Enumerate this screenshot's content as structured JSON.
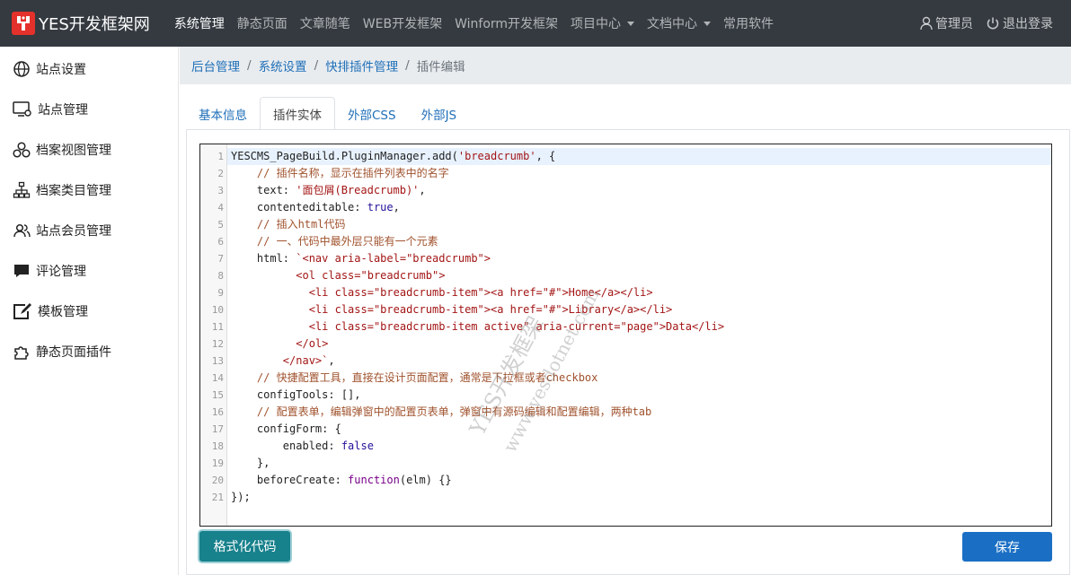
{
  "app": {
    "brand": "YES开发框架网",
    "brand_color": "#e4312b"
  },
  "topnav": {
    "items": [
      {
        "label": "系统管理",
        "active": true,
        "dropdown": false
      },
      {
        "label": "静态页面",
        "active": false,
        "dropdown": false
      },
      {
        "label": "文章随笔",
        "active": false,
        "dropdown": false
      },
      {
        "label": "WEB开发框架",
        "active": false,
        "dropdown": false
      },
      {
        "label": "Winform开发框架",
        "active": false,
        "dropdown": false
      },
      {
        "label": "项目中心",
        "active": false,
        "dropdown": true
      },
      {
        "label": "文档中心",
        "active": false,
        "dropdown": true
      },
      {
        "label": "常用软件",
        "active": false,
        "dropdown": false
      }
    ],
    "user_label": "管理员",
    "user_icon": "user-icon",
    "logout_label": "退出登录",
    "logout_icon": "power-icon"
  },
  "sidebar": {
    "items": [
      {
        "label": "站点设置",
        "icon": "globe-icon"
      },
      {
        "label": "站点管理",
        "icon": "monitor-gear-icon"
      },
      {
        "label": "档案视图管理",
        "icon": "circles-icon"
      },
      {
        "label": "档案类目管理",
        "icon": "sitemap-icon"
      },
      {
        "label": "站点会员管理",
        "icon": "users-icon"
      },
      {
        "label": "评论管理",
        "icon": "comment-icon"
      },
      {
        "label": "模板管理",
        "icon": "edit-box-icon"
      },
      {
        "label": "静态页面插件",
        "icon": "puzzle-icon"
      }
    ]
  },
  "breadcrumb": {
    "items": [
      "后台管理",
      "系统设置",
      "快排插件管理"
    ],
    "current": "插件编辑"
  },
  "tabs": {
    "items": [
      "基本信息",
      "插件实体",
      "外部CSS",
      "外部JS"
    ],
    "active_index": 1
  },
  "editor": {
    "lines": [
      "YESCMS_PageBuild.PluginManager.add('breadcrumb', {",
      "    // 插件名称，显示在插件列表中的名字",
      "    text: '面包屑(Breadcrumb)',",
      "    contenteditable: true,",
      "    // 插入html代码",
      "    // 一、代码中最外层只能有一个元素",
      "    html: `<nav aria-label=\"breadcrumb\">",
      "          <ol class=\"breadcrumb\">",
      "            <li class=\"breadcrumb-item\"><a href=\"#\">Home</a></li>",
      "            <li class=\"breadcrumb-item\"><a href=\"#\">Library</a></li>",
      "            <li class=\"breadcrumb-item active\" aria-current=\"page\">Data</li>",
      "          </ol>",
      "        </nav>`,",
      "    // 快捷配置工具，直接在设计页面配置，通常是下拉框或者checkbox",
      "    configTools: [],",
      "    // 配置表单，编辑弹窗中的配置页表单，弹窗中有源码编辑和配置编辑，两种tab",
      "    configForm: {",
      "        enabled: false",
      "    },",
      "    beforeCreate: function(elm) {}",
      "});"
    ],
    "highlighted_line": 1
  },
  "watermark": {
    "line1": "YES开发框架",
    "line2": "www.yesdotnet.com"
  },
  "buttons": {
    "format_label": "格式化代码",
    "save_label": "保存"
  },
  "colors": {
    "topnav_bg": "#343a40",
    "link": "#1f6fb8",
    "format_btn": "#17818c",
    "save_btn": "#1a6fc4"
  }
}
